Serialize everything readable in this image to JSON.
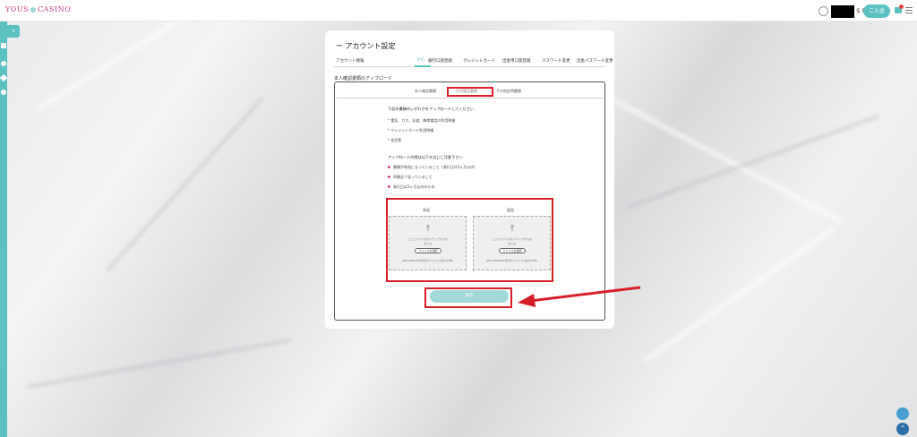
{
  "header": {
    "logo_left": "YOUS",
    "logo_right": "CASINO",
    "balance": "$ 0",
    "deposit_label": "ご入金"
  },
  "sidebar": {
    "icons": [
      "grid-icon",
      "chip-icon",
      "ticket-icon",
      "settings-icon"
    ]
  },
  "panel": {
    "title": "ー アカウント設定",
    "tabs": [
      {
        "label": "アカウント情報"
      },
      {
        "label": "KYC"
      },
      {
        "label": "銀行口座登録"
      },
      {
        "label": "クレジットカード"
      },
      {
        "label": "出金用口座登録"
      },
      {
        "label": "パスワード変更"
      },
      {
        "label": "出金パスワード変更"
      }
    ],
    "section_title": "本人確認書類のアップロード",
    "subtabs": [
      {
        "label": "本人確認書類"
      },
      {
        "label": "住所確認書類"
      },
      {
        "label": "その他証明書類"
      }
    ],
    "instructions": {
      "head1": "下記の書類のいずれかをアップロードしてください",
      "items1": [
        "* 電気、ガス、水道、携帯電話の利用明細",
        "* クレジットカード利用明細",
        "* 住民票"
      ],
      "head2": "アップロードの際は以下の点にご注意下さい",
      "items2": [
        "書類が有効になっていること（発行日付3ヶ月以内）",
        "四隅全て収っていること",
        "発行日は3ヶ月以内のもの"
      ]
    },
    "upload": {
      "front_label": "表面",
      "back_label": "裏面",
      "drop_text": "ここにファイルをドラッグするか",
      "drop_text2": "または",
      "file_button": "ファイルを選択",
      "note": "JPEG/PNG/PDF形式のファイル(最大5MB)"
    },
    "submit_label": "送信"
  },
  "colors": {
    "accent": "#5cc1c1",
    "highlight": "#d81e28",
    "brand": "#c63c86"
  }
}
